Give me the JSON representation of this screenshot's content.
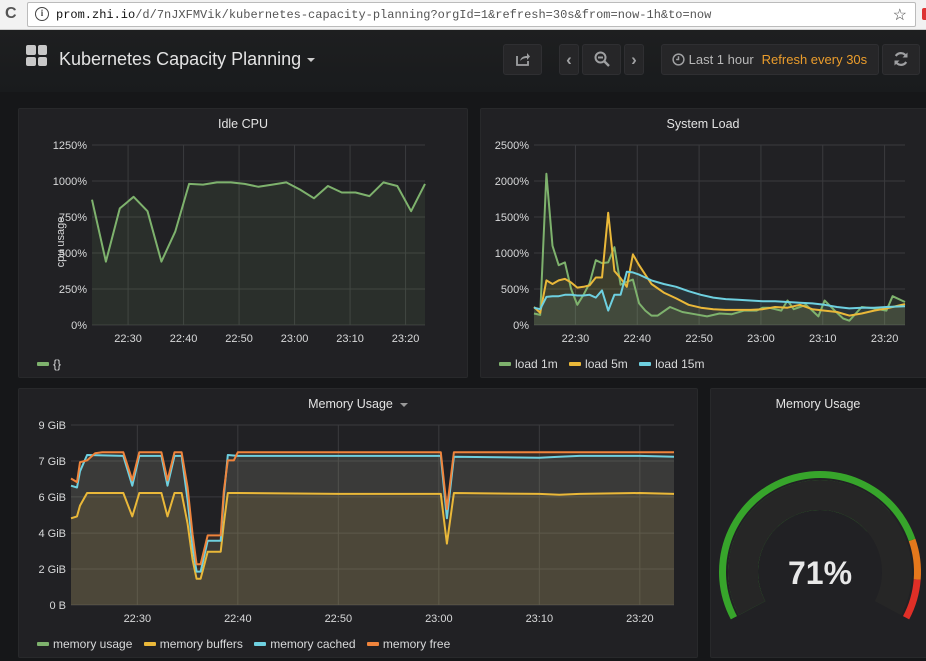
{
  "browser": {
    "url_host": "prom.zhi.io",
    "url_path": "/d/7nJXFMVik/kubernetes-capacity-planning?orgId=1&refresh=30s&from=now-1h&to=now"
  },
  "header": {
    "dashboard_title": "Kubernetes Capacity Planning",
    "time_range_label": "Last 1 hour",
    "refresh_label": "Refresh every 30s"
  },
  "colors": {
    "green": "#7eb26d",
    "yellow": "#eab839",
    "cyan": "#6ed0e0",
    "orange": "#ef843c",
    "gauge_green": "#37a52b",
    "gauge_orange": "#e5781c",
    "gauge_red": "#e02f27"
  },
  "chart_data": [
    {
      "id": "idle_cpu",
      "type": "line",
      "title": "Idle CPU",
      "ylabel": "cpu usage",
      "xlabel": "",
      "ylim": [
        0,
        1250
      ],
      "yticks": [
        "0%",
        "250%",
        "500%",
        "750%",
        "1000%",
        "1250%"
      ],
      "xticks": [
        "22:30",
        "22:40",
        "22:50",
        "23:00",
        "23:10",
        "23:20"
      ],
      "x_range_min": [
        23.5,
        83.5
      ],
      "xtick_values_min": [
        30,
        40,
        50,
        60,
        70,
        80
      ],
      "grid": true,
      "legend_position": "bottom-left",
      "series": [
        {
          "name": "{}",
          "color": "#7eb26d",
          "x": [
            23.5,
            26,
            28.5,
            31,
            33.5,
            36,
            38.5,
            41,
            43.5,
            46,
            48.5,
            51,
            53.5,
            56,
            58.5,
            61,
            63.5,
            66,
            68.5,
            71,
            73.5,
            76,
            78.5,
            81,
            83.5
          ],
          "values": [
            870,
            440,
            810,
            890,
            790,
            440,
            650,
            980,
            975,
            990,
            990,
            980,
            960,
            975,
            990,
            940,
            880,
            965,
            920,
            920,
            895,
            990,
            965,
            790,
            980
          ]
        }
      ]
    },
    {
      "id": "system_load",
      "type": "line",
      "title": "System Load",
      "ylabel": "",
      "xlabel": "",
      "ylim": [
        0,
        2500
      ],
      "yticks": [
        "0%",
        "500%",
        "1000%",
        "1500%",
        "2000%",
        "2500%"
      ],
      "xticks": [
        "22:30",
        "22:40",
        "22:50",
        "23:00",
        "23:10",
        "23:20"
      ],
      "x_range_min": [
        23.3,
        83.3
      ],
      "xtick_values_min": [
        30,
        40,
        50,
        60,
        70,
        80
      ],
      "grid": true,
      "legend_position": "bottom-left",
      "series": [
        {
          "name": "load 1m",
          "color": "#7eb26d",
          "x": [
            23.3,
            24.3,
            25.3,
            26.3,
            27.3,
            28.3,
            29.3,
            30.3,
            31.3,
            32.3,
            33.3,
            34.3,
            35.3,
            36.3,
            37.3,
            38.3,
            39.3,
            40.3,
            41.3,
            42.3,
            43.3,
            45.3,
            47.3,
            49.3,
            51.3,
            53.3,
            55.3,
            57.3,
            59.3,
            60.3,
            61.3,
            63.3,
            64.3,
            65.3,
            66.3,
            67.3,
            69.3,
            70.3,
            72.3,
            73.3,
            74.3,
            76.3,
            78.3,
            80.3,
            81.3,
            83.3
          ],
          "values": [
            160,
            140,
            2100,
            1100,
            830,
            870,
            500,
            280,
            420,
            580,
            900,
            860,
            870,
            1080,
            560,
            600,
            630,
            300,
            200,
            130,
            130,
            250,
            180,
            150,
            120,
            160,
            150,
            200,
            200,
            240,
            240,
            200,
            340,
            220,
            250,
            280,
            120,
            340,
            170,
            90,
            60,
            250,
            230,
            200,
            400,
            320
          ]
        },
        {
          "name": "load 5m",
          "color": "#eab839",
          "x": [
            23.3,
            24.3,
            25.3,
            26.3,
            27.3,
            28.3,
            29.3,
            30.3,
            31.3,
            32.3,
            33.3,
            34.3,
            35.3,
            36.3,
            37.3,
            38.3,
            39.3,
            40.3,
            42.3,
            44.3,
            46.3,
            48.3,
            50.3,
            52.3,
            54.3,
            56.3,
            58.3,
            60.3,
            62.3,
            64.3,
            66.3,
            68.3,
            70.3,
            72.3,
            74.3,
            76.3,
            78.3,
            80.3,
            83.3
          ],
          "values": [
            250,
            170,
            620,
            570,
            620,
            640,
            590,
            520,
            530,
            550,
            660,
            660,
            1560,
            750,
            650,
            530,
            980,
            830,
            570,
            450,
            370,
            280,
            240,
            220,
            210,
            210,
            210,
            220,
            250,
            240,
            280,
            220,
            200,
            180,
            130,
            160,
            200,
            230,
            290
          ]
        },
        {
          "name": "load 15m",
          "color": "#6ed0e0",
          "x": [
            23.3,
            24.3,
            25.3,
            26.3,
            27.3,
            28.3,
            29.3,
            30.3,
            31.3,
            32.3,
            33.3,
            34.3,
            35.3,
            36.3,
            37.3,
            38.3,
            39.3,
            40.3,
            42.3,
            44.3,
            46.3,
            48.3,
            50.3,
            52.3,
            54.3,
            56.3,
            58.3,
            60.3,
            62.3,
            64.3,
            66.3,
            68.3,
            70.3,
            72.3,
            74.3,
            76.3,
            78.3,
            80.3,
            83.3
          ],
          "values": [
            240,
            220,
            390,
            400,
            400,
            420,
            420,
            410,
            410,
            420,
            380,
            480,
            200,
            420,
            420,
            740,
            730,
            700,
            620,
            570,
            530,
            470,
            420,
            380,
            360,
            350,
            340,
            330,
            330,
            320,
            310,
            300,
            280,
            250,
            230,
            240,
            240,
            250,
            260
          ]
        }
      ]
    },
    {
      "id": "memory_usage",
      "type": "line",
      "title": "Memory Usage",
      "ylabel": "",
      "xlabel": "",
      "ylim": [
        0,
        9.96
      ],
      "yticks": [
        "0 B",
        "2 GiB",
        "4 GiB",
        "6 GiB",
        "7 GiB",
        "9 GiB"
      ],
      "ytick_values": [
        0,
        1.99,
        3.98,
        5.98,
        7.97,
        9.96
      ],
      "xticks": [
        "22:30",
        "22:40",
        "22:50",
        "23:00",
        "23:10",
        "23:20"
      ],
      "x_range_min": [
        23.4,
        83.4
      ],
      "xtick_values_min": [
        30,
        40,
        50,
        60,
        70,
        80
      ],
      "grid": true,
      "legend_position": "bottom-left",
      "series": [
        {
          "name": "memory usage",
          "color": "#7eb26d",
          "x": [],
          "values": []
        },
        {
          "name": "memory buffers",
          "color": "#eab839",
          "x": [
            23.4,
            24.0,
            24.3,
            25.0,
            28.6,
            29.5,
            30.2,
            32.4,
            33.0,
            33.7,
            34.4,
            35.0,
            35.5,
            35.9,
            36.3,
            37.0,
            38.3,
            38.6,
            39.0,
            40,
            50,
            60.2,
            60.8,
            61.5,
            70,
            72,
            74,
            80,
            83.4
          ],
          "values": [
            4.8,
            4.9,
            5.5,
            6.2,
            6.2,
            4.9,
            6.2,
            6.2,
            4.9,
            6.2,
            6.2,
            4.5,
            2.5,
            1.45,
            1.45,
            2.95,
            2.95,
            4.5,
            6.2,
            6.2,
            6.15,
            6.15,
            3.4,
            6.2,
            6.15,
            6.1,
            6.15,
            6.2,
            6.15
          ]
        },
        {
          "name": "memory cached",
          "color": "#6ed0e0",
          "x": [
            23.4,
            24.0,
            24.3,
            25.0,
            28.6,
            29.5,
            30.2,
            32.4,
            33.0,
            33.7,
            34.4,
            35.0,
            35.5,
            35.9,
            36.3,
            37.0,
            38.3,
            38.6,
            39.0,
            40,
            50,
            60.2,
            60.8,
            61.5,
            70,
            72,
            74,
            80,
            83.4
          ],
          "values": [
            6.6,
            6.5,
            7.4,
            8.3,
            8.25,
            6.6,
            8.25,
            8.25,
            6.6,
            8.25,
            8.25,
            5.8,
            3.2,
            1.85,
            1.85,
            3.55,
            3.55,
            6.0,
            8.3,
            8.25,
            8.25,
            8.25,
            4.8,
            8.2,
            8.15,
            8.2,
            8.25,
            8.25,
            8.2
          ]
        },
        {
          "name": "memory free",
          "color": "#ef843c",
          "x": [
            23.4,
            24.0,
            24.3,
            25.0,
            25.8,
            26.5,
            28.6,
            29.5,
            30.2,
            32.4,
            33.0,
            33.7,
            34.4,
            35.0,
            35.5,
            35.9,
            36.3,
            37.0,
            38.3,
            38.6,
            39.0,
            39.6,
            40,
            50,
            60.2,
            60.8,
            61.5,
            70,
            80,
            83.4
          ],
          "values": [
            7.0,
            6.8,
            7.9,
            8.0,
            8.4,
            8.45,
            8.45,
            6.9,
            8.45,
            8.45,
            6.9,
            8.45,
            8.45,
            6.5,
            3.9,
            2.25,
            2.25,
            3.85,
            3.85,
            6.3,
            8.0,
            8.0,
            8.45,
            8.45,
            8.45,
            5.3,
            8.45,
            8.45,
            8.45,
            8.45
          ]
        }
      ]
    },
    {
      "id": "memory_gauge",
      "type": "gauge",
      "title": "Memory Usage",
      "value_label": "71%",
      "value": 71,
      "min": 0,
      "max": 100,
      "thresholds": [
        {
          "from": 0,
          "to": 80,
          "color": "#37a52b"
        },
        {
          "from": 80,
          "to": 90,
          "color": "#e5781c"
        },
        {
          "from": 90,
          "to": 100,
          "color": "#e02f27"
        }
      ]
    }
  ]
}
